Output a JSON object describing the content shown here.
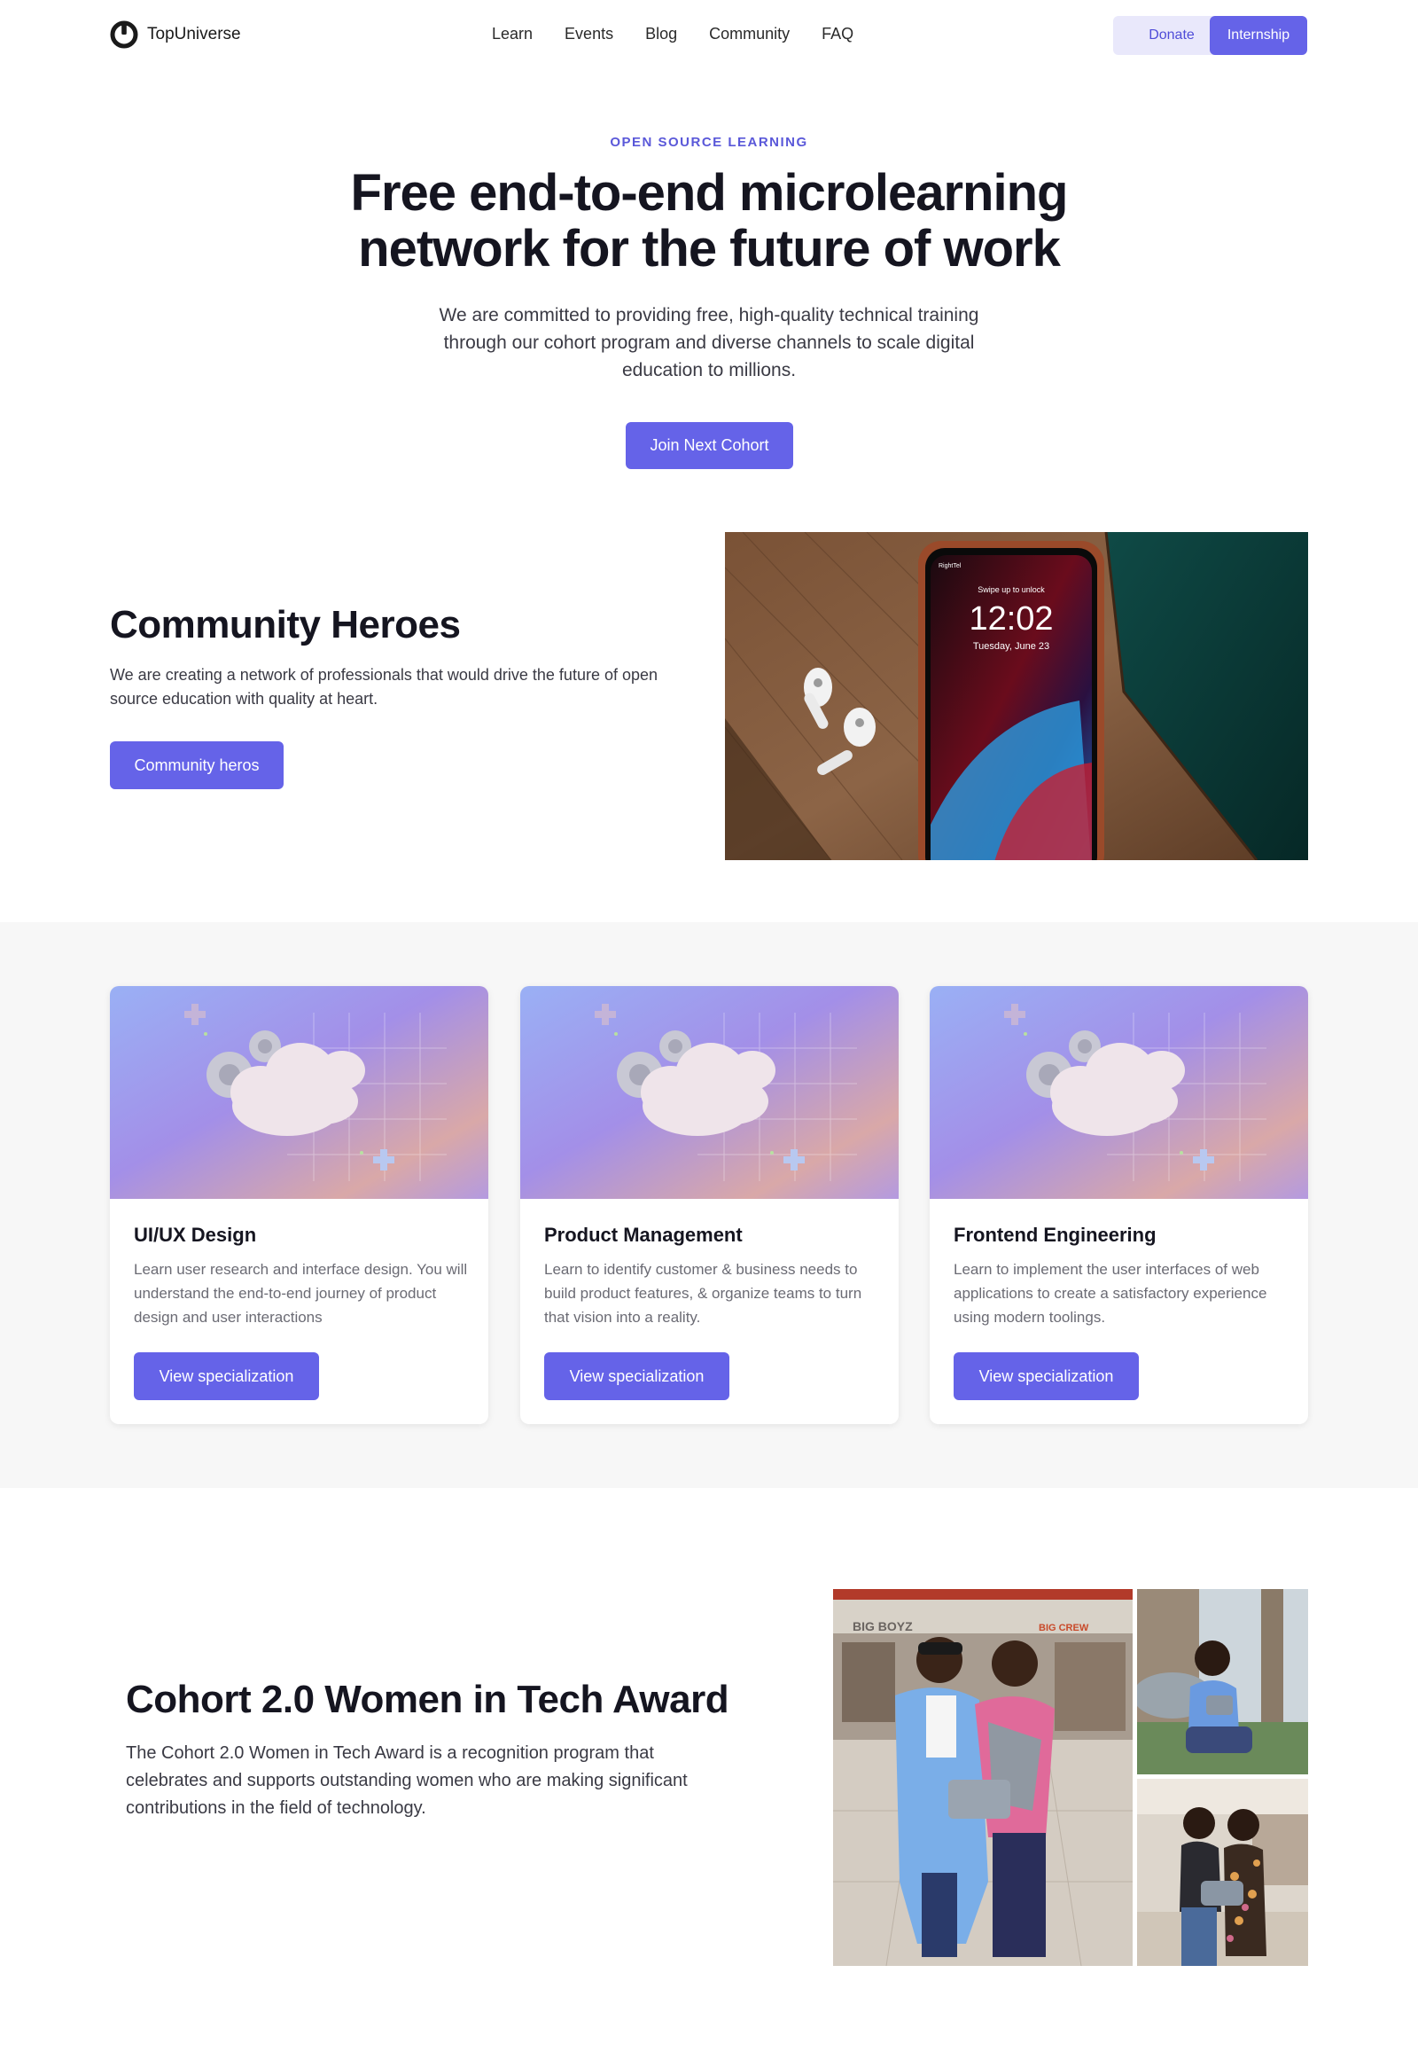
{
  "nav": {
    "brand": "TopUniverse",
    "links": [
      "Learn",
      "Events",
      "Blog",
      "Community",
      "FAQ"
    ],
    "donate_label": "Donate",
    "internship_label": "Internship"
  },
  "hero": {
    "eyebrow": "OPEN SOURCE LEARNING",
    "title": "Free end-to-end microlearning network for the future of work",
    "description": "We are committed to providing free, high-quality technical training through our cohort program and diverse channels to scale digital education to millions.",
    "cta_label": "Join Next Cohort"
  },
  "community": {
    "title": "Community Heroes",
    "description": "We are creating a network of professionals that would drive the future of open source education with quality at heart.",
    "cta_label": "Community heros",
    "phone_time": "12:02",
    "phone_date": "Tuesday, June 23",
    "phone_lock_text": "Swipe up to unlock",
    "phone_carrier": "RightTel"
  },
  "specializations": [
    {
      "title": "UI/UX Design",
      "description": "Learn user research and interface design. You will understand the end-to-end journey of product design and user interactions",
      "button_label": "View specialization"
    },
    {
      "title": "Product Management",
      "description": "Learn to identify customer & business needs to build product features, & organize teams to turn that vision into a reality.",
      "button_label": "View specialization"
    },
    {
      "title": "Frontend Engineering",
      "description": "Learn to implement the user interfaces of web applications to create a satisfactory experience using modern toolings.",
      "button_label": "View specialization"
    }
  ],
  "award": {
    "title": "Cohort 2.0 Women in Tech Award",
    "description": "The Cohort 2.0 Women in Tech Award is a recognition program that celebrates and supports outstanding women who are making significant contributions in the field of technology.",
    "sign_left": "BIG BOYZ",
    "sign_right": "BIG CREW"
  },
  "colors": {
    "accent": "#6563e8",
    "accent_light": "#e9e8fb",
    "band_bg": "#f7f7f7"
  }
}
